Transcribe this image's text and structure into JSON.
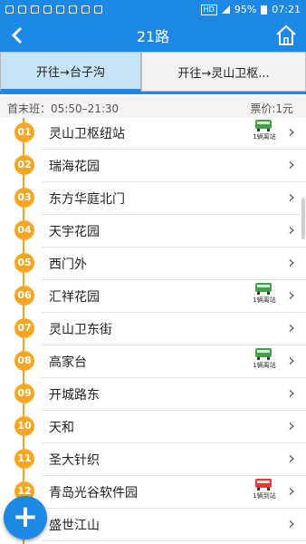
{
  "status_bar": {
    "hd": "HD",
    "battery": "95%",
    "time": "07:21"
  },
  "title_bar": {
    "title": "21路",
    "back_icon": "chevron-left-icon",
    "home_icon": "home-icon"
  },
  "tabs": [
    {
      "label": "开往→台子沟",
      "selected": true
    },
    {
      "label": "开往→灵山卫枢...",
      "selected": false
    }
  ],
  "info": {
    "schedule": "首末班：05:50–21:30",
    "fare": "票价:1元"
  },
  "colors": {
    "primary": "#1e88e5",
    "stop_marker": "#f5a623",
    "bus_green": "#43a047",
    "bus_red": "#e53935"
  },
  "stops": [
    {
      "num": "01",
      "name": "灵山卫枢纽站",
      "bus": {
        "color": "green",
        "label": "1辆离站"
      }
    },
    {
      "num": "02",
      "name": "瑞海花园"
    },
    {
      "num": "03",
      "name": "东方华庭北门"
    },
    {
      "num": "04",
      "name": "天宇花园"
    },
    {
      "num": "05",
      "name": "西门外"
    },
    {
      "num": "06",
      "name": "汇祥花园",
      "bus": {
        "color": "green",
        "label": "1辆离站"
      }
    },
    {
      "num": "07",
      "name": "灵山卫东街"
    },
    {
      "num": "08",
      "name": "高家台",
      "bus": {
        "color": "green",
        "label": "1辆离站"
      }
    },
    {
      "num": "09",
      "name": "开城路东"
    },
    {
      "num": "10",
      "name": "天和"
    },
    {
      "num": "11",
      "name": "圣大针织"
    },
    {
      "num": "12",
      "name": "青岛光谷软件园",
      "bus": {
        "color": "red",
        "label": "1辆到站"
      }
    },
    {
      "num": "13",
      "name": "盛世江山"
    }
  ],
  "fab": {
    "label": "+",
    "icon": "plus-icon"
  }
}
